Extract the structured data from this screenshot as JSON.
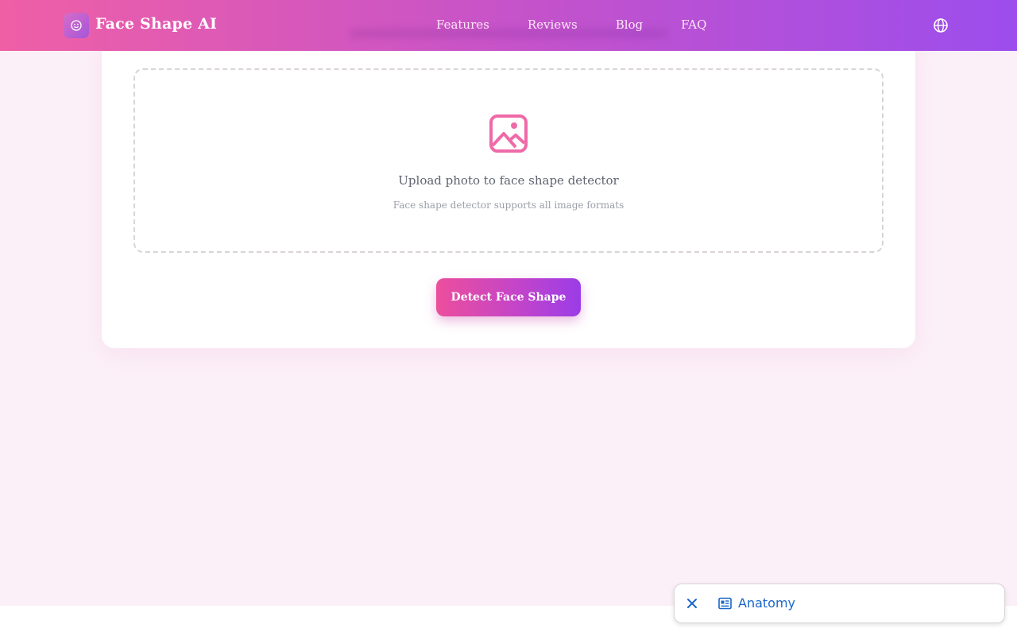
{
  "header": {
    "brand": "Face Shape AI",
    "nav": [
      "Features",
      "Reviews",
      "Blog",
      "FAQ"
    ]
  },
  "upload": {
    "title": "Upload photo to face shape detector",
    "subtitle": "Face shape detector supports all image formats"
  },
  "actions": {
    "detect_label": "Detect Face Shape"
  },
  "popup": {
    "label": "Anatomy"
  },
  "icons": {
    "logo": "smiley-face-icon",
    "language": "globe-icon",
    "upload": "image-icon",
    "close": "close-icon",
    "article": "article-icon"
  },
  "colors": {
    "nav_gradient_start": "#ef5fa6",
    "nav_gradient_end": "#9c4ded",
    "accent_pink": "#ec4e9c",
    "accent_purple": "#9b3ce8",
    "link_blue": "#1a66c9"
  }
}
